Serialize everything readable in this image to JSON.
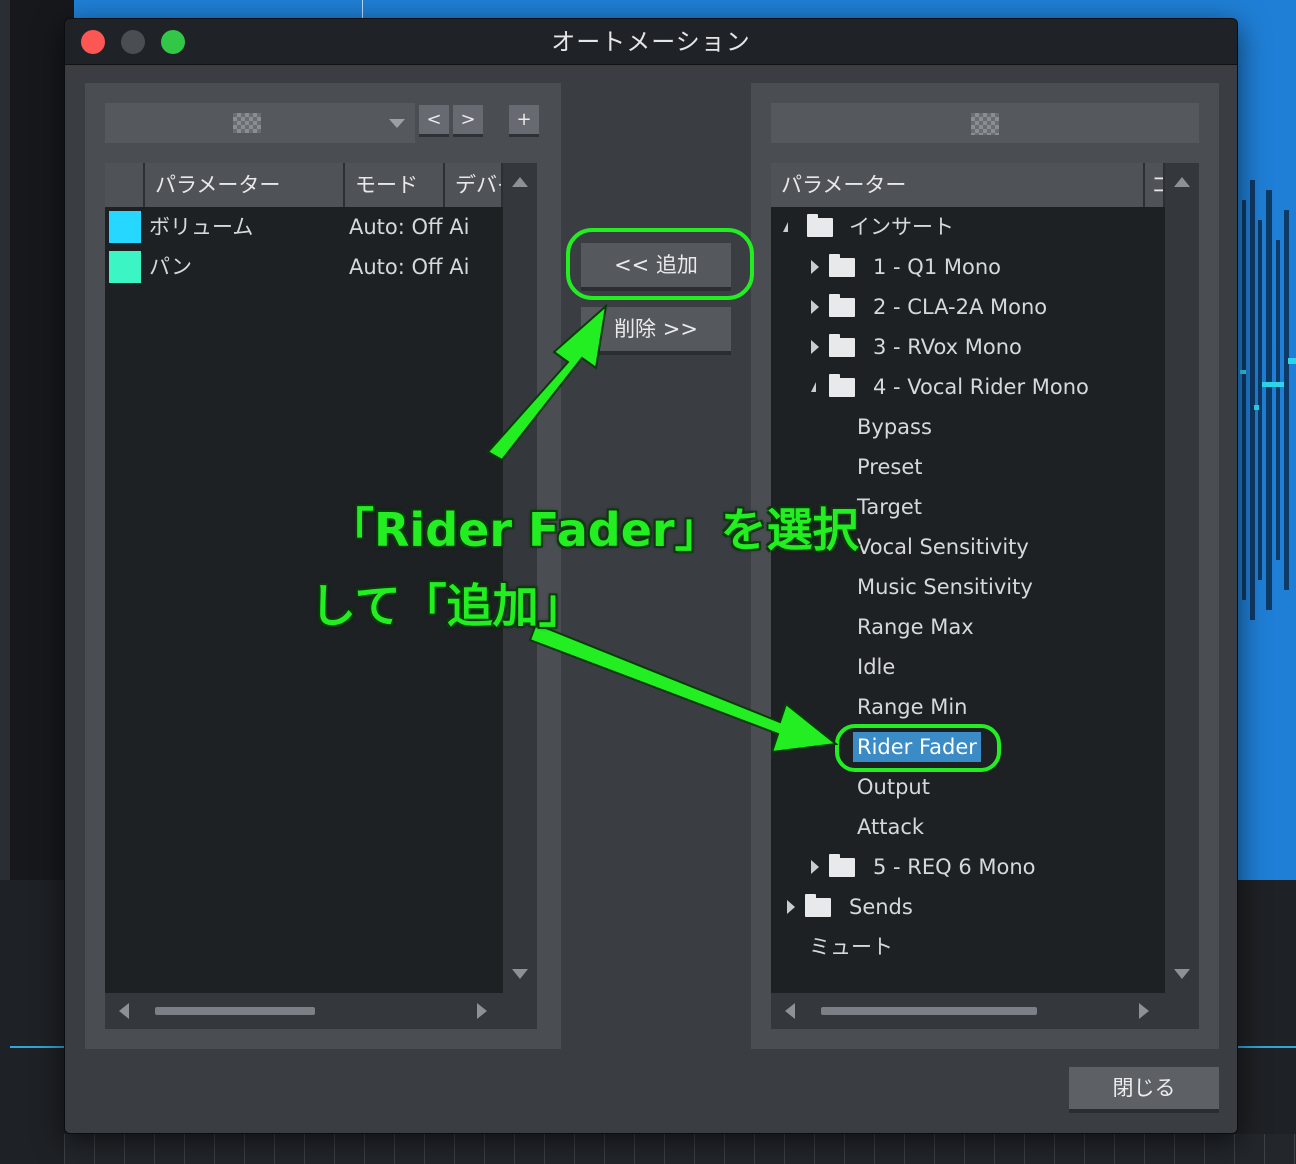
{
  "dialog": {
    "title": "オートメーション",
    "close_button": "閉じる"
  },
  "left_panel": {
    "prev_button": "<",
    "next_button": ">",
    "add_button": "+",
    "columns": [
      "パラメーター",
      "モード",
      "デバイス"
    ],
    "rows": [
      {
        "name": "ボリューム",
        "mode": "Auto: Off",
        "device": "Ai",
        "color": "#26d7ff"
      },
      {
        "name": "パン",
        "mode": "Auto: Off",
        "device": "Ai",
        "color": "#3cf5c4"
      }
    ]
  },
  "middle": {
    "add_button": "<< 追加",
    "remove_button": "削除 >>"
  },
  "right_panel": {
    "columns": [
      "パラメーター",
      "コ"
    ],
    "tree": {
      "inserts": "インサート",
      "plugins": [
        "1 - Q1 Mono",
        "2 - CLA-2A Mono",
        "3 - RVox Mono",
        "4 - Vocal Rider Mono",
        "5 - REQ 6 Mono"
      ],
      "vocal_rider_params": [
        "Bypass",
        "Preset",
        "Target",
        "Vocal Sensitivity",
        "Music Sensitivity",
        "Range Max",
        "Idle",
        "Range Min",
        "Rider Fader",
        "Output",
        "Attack"
      ],
      "selected": "Rider Fader",
      "sends": "Sends",
      "mute": "ミュート"
    }
  },
  "annotation": {
    "line1": "「Rider Fader」を選択",
    "line2": "して「追加」",
    "color": "#22ee22"
  }
}
